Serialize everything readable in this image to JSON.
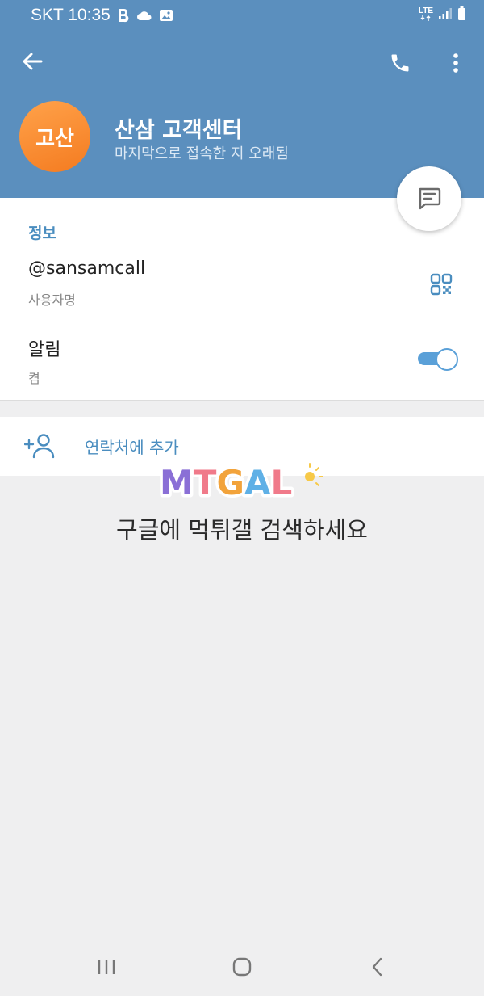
{
  "status_bar": {
    "carrier_time": "SKT 10:35",
    "lte_label": "LTE",
    "icons": [
      "b-app-icon",
      "cloud-icon",
      "gallery-icon",
      "lte-icon",
      "signal-icon",
      "battery-icon"
    ]
  },
  "header": {
    "background_color": "#5b8fbe",
    "avatar_text": "고산",
    "avatar_color": "#f78b2b",
    "name": "산삼 고객센터",
    "last_seen": "마지막으로 접속한 지 오래됨"
  },
  "info": {
    "section_title": "정보",
    "username": "@sansamcall",
    "username_label": "사용자명",
    "notifications": "알림",
    "notifications_value": "켬",
    "notifications_on": true
  },
  "actions": {
    "add_contact_label": "연락처에 추가",
    "accent_color": "#4a8dbf"
  },
  "watermark": {
    "logo_text": "MTGAL",
    "caption": "구글에 먹튀갤 검색하세요"
  },
  "nav_bar": {
    "icons": [
      "recent-apps-icon",
      "home-icon",
      "back-icon"
    ]
  }
}
